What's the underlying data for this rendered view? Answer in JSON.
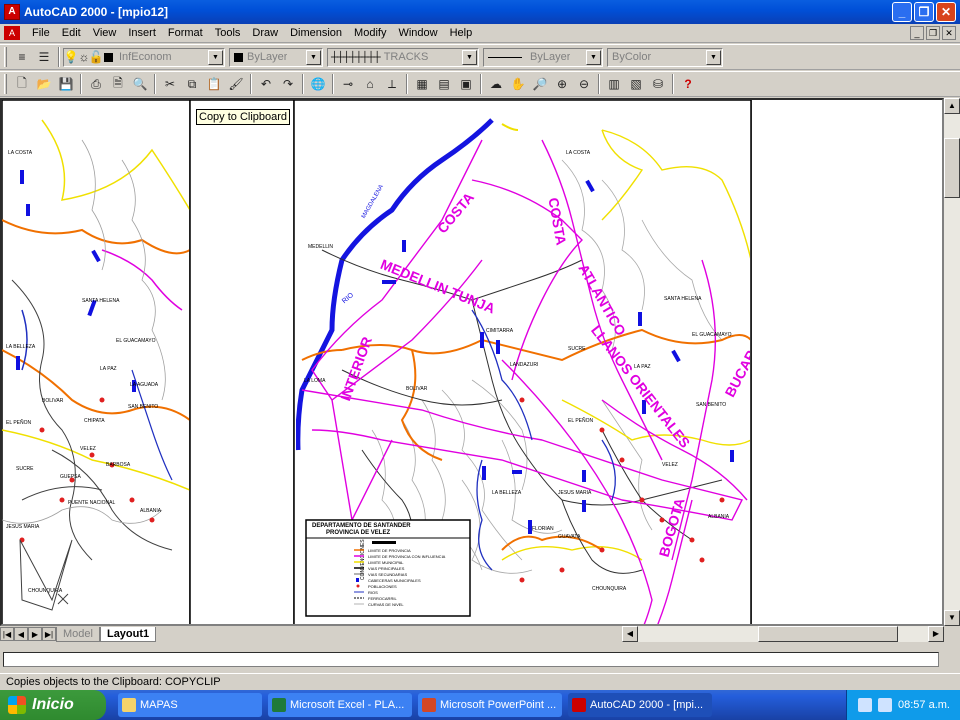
{
  "window": {
    "title": "AutoCAD 2000 - [mpio12]",
    "icon": "autocad-icon"
  },
  "menubar": {
    "items": [
      "File",
      "Edit",
      "View",
      "Insert",
      "Format",
      "Tools",
      "Draw",
      "Dimension",
      "Modify",
      "Window",
      "Help"
    ]
  },
  "properties_toolbar": {
    "layer": "InfEconom",
    "color": "ByLayer",
    "linetype": "TRACKS",
    "lineweight": "ByLayer",
    "plotstyle": "ByColor"
  },
  "tooltip": "Copy to Clipboard",
  "layout_tabs": {
    "items": [
      "Model",
      "Layout1"
    ],
    "active": "Layout1"
  },
  "command_status": "Copies objects to the Clipboard:  COPYCLIP",
  "taskbar": {
    "start_label": "Inicio",
    "items": [
      "MAPAS",
      "Microsoft Excel - PLA...",
      "Microsoft PowerPoint ...",
      "AutoCAD 2000 - [mpi..."
    ],
    "clock": "08:57 a.m."
  },
  "drawing": {
    "legend_title": "DEPARTAMENTO DE SANTANDER",
    "legend_subtitle": "PROVINCIA DE VELEZ",
    "legend_items": [
      "LIMITE DE PROVINCIA",
      "LIMITE DE PROVINCIA CON INFLUENCIA",
      "LIMITE MUNICIPAL",
      "VIAS PRINCIPALES",
      "VIAS SECUNDARIAS",
      "CABECERAS MUNICIPALES",
      "POBLACIONES",
      "RIOS",
      "FERROCARRIL",
      "CURVAS DE NIVEL"
    ],
    "legend_side": "CONVENCIONES",
    "corridors": [
      "COSTA",
      "COSTA",
      "MEDELLIN TUNJA",
      "ATLANTICO",
      "INTERIOR",
      "LLANOS ORIENTALES",
      "BUCARAMANGA",
      "BOGOTA"
    ],
    "places_left": [
      "LA COSTA",
      "SANTA HELENA",
      "EL GUACAMAYO",
      "LA PAZ",
      "BOLIVAR",
      "CHIPATA",
      "EL PEÑON",
      "VELEZ",
      "SUCRE",
      "BARBOSA",
      "GUEPSA",
      "PUENTE NACIONAL",
      "JESUS MARIA",
      "ALBANIA",
      "CHOUNQUIRA",
      "LA BELLEZA",
      "SAN BENITO",
      "LA AGUADA"
    ],
    "places_right": [
      "LA COSTA",
      "MEDELLIN",
      "CIMITARRA",
      "LANDAZURI",
      "LA LOMA",
      "SUCRE",
      "BOLIVAR",
      "SANTA HELENA",
      "LA PAZ",
      "EL GUACAMAYO",
      "SAN BENITO",
      "EL PEÑON",
      "VELEZ",
      "LA BELLEZA",
      "JESUS MARIA",
      "ALBANIA",
      "FLORIAN",
      "GUAVATA",
      "CHOUNQUIRA"
    ],
    "river": "MAGDALENA",
    "river_short": "RIO"
  }
}
